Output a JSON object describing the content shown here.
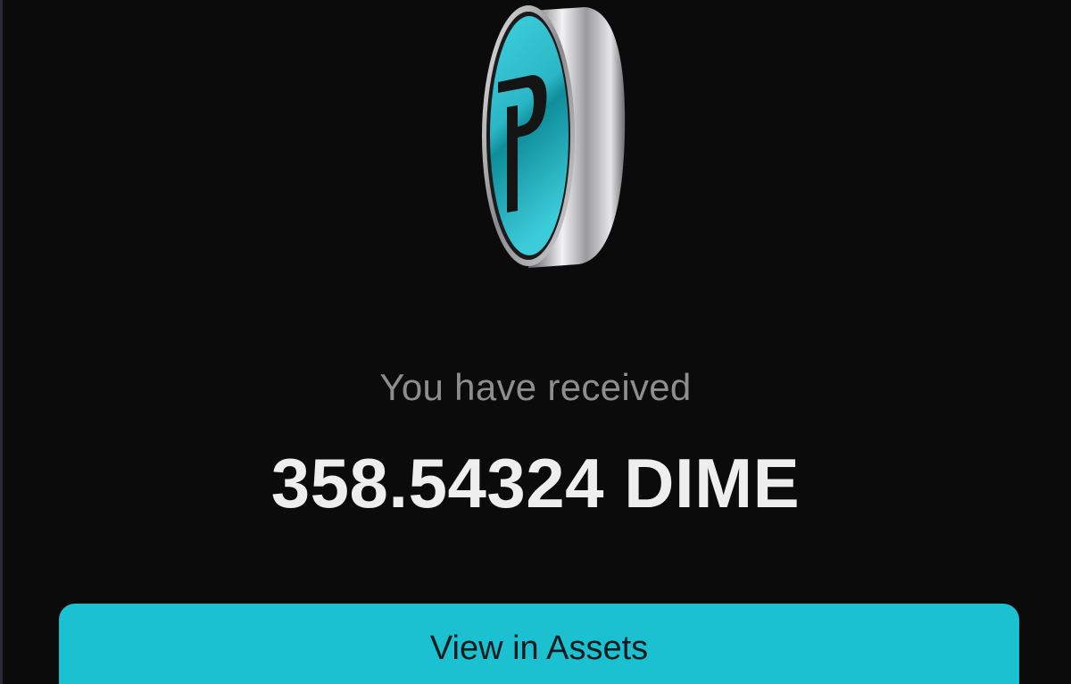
{
  "coin": {
    "icon": "pepecoin-logo-icon",
    "colors": {
      "face": "#2bb7c6",
      "face_dark": "#0c6f7a",
      "rim": "#c9c9cc",
      "glyph": "#141414"
    }
  },
  "message": {
    "label": "You have received",
    "amount": "358.54324 DIME"
  },
  "actions": {
    "view_assets_label": "View in Assets",
    "accent": "#1cc1d1"
  }
}
